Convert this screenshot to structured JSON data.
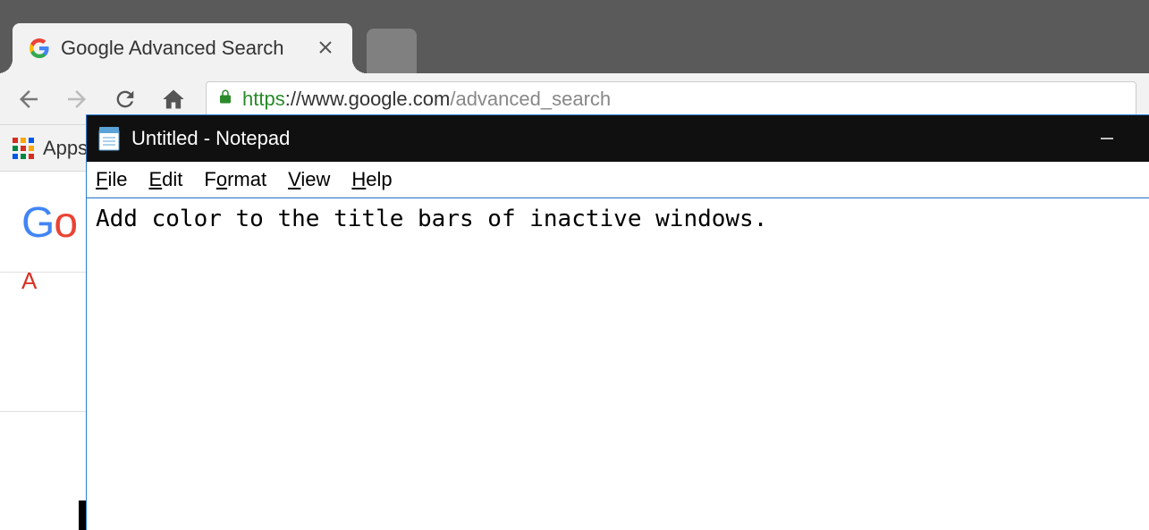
{
  "chrome": {
    "active_tab": {
      "title": "Google Advanced Search",
      "favicon_name": "google-favicon"
    },
    "toolbar": {
      "url_secure_prefix": "https",
      "url_domain": "://www.google.com",
      "url_path": "/advanced_search"
    },
    "bookmarks": {
      "apps_label": "Apps"
    },
    "page": {
      "logo_visible_text": "Go",
      "advanced_first_letter": "A"
    }
  },
  "notepad": {
    "title": "Untitled - Notepad",
    "menus": {
      "file": "File",
      "edit": "Edit",
      "format": "Format",
      "view": "View",
      "help": "Help"
    },
    "content": "Add color to the title bars of inactive windows."
  }
}
